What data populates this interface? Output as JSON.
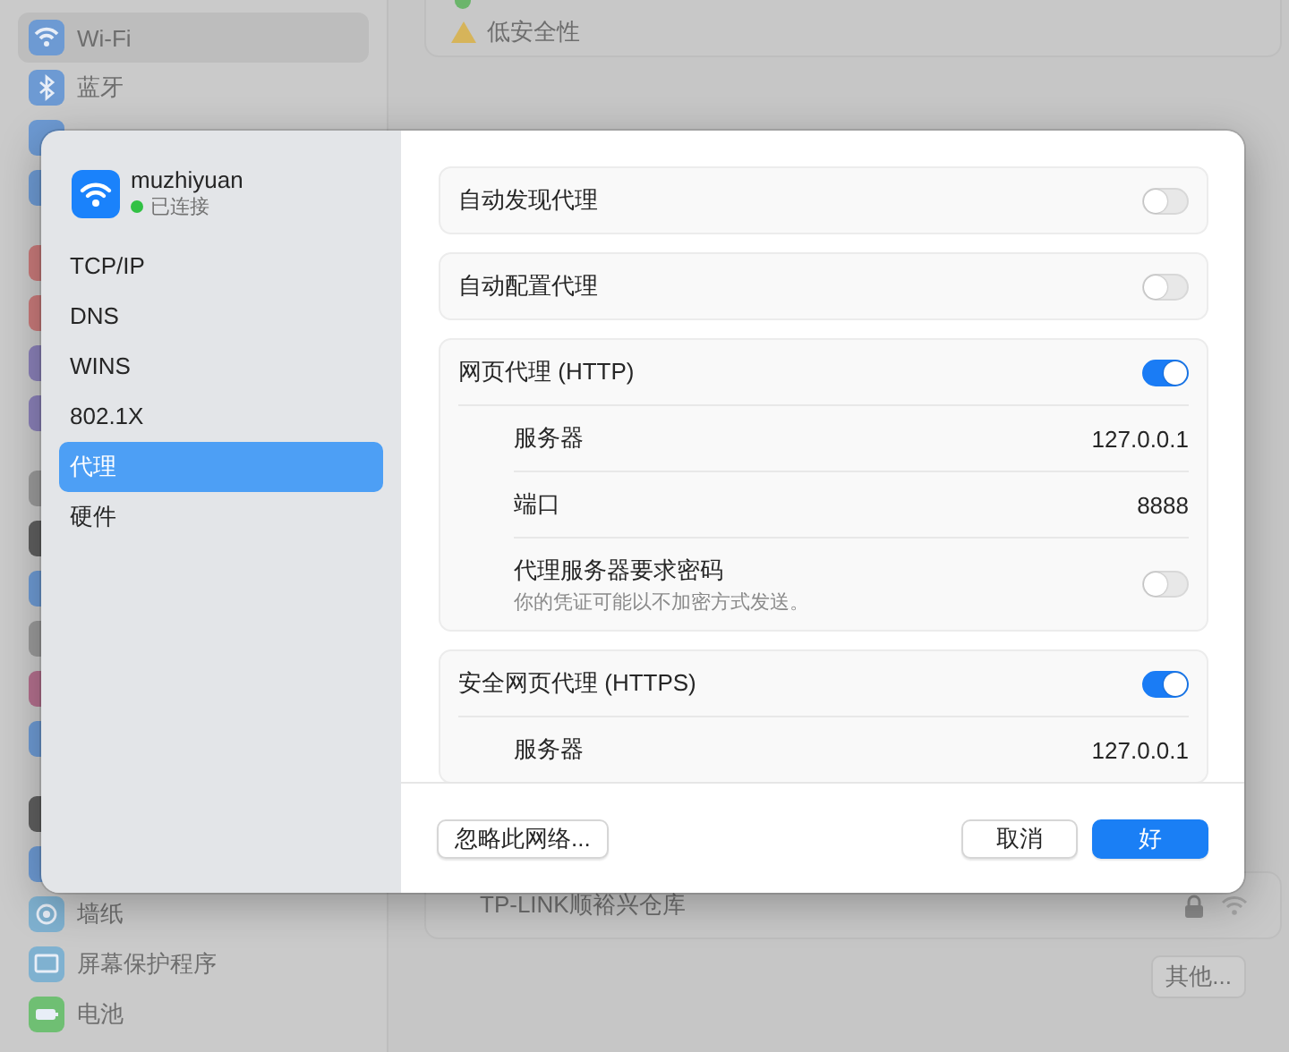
{
  "background": {
    "sidebar": [
      {
        "kind": "wifi",
        "label": "Wi-Fi",
        "selected": true
      },
      {
        "kind": "bluetooth",
        "label": "蓝牙",
        "selected": false
      },
      {
        "kind": "app"
      },
      {
        "kind": "app"
      },
      {
        "kind": "app"
      },
      {
        "kind": "app"
      },
      {
        "kind": "app"
      },
      {
        "kind": "app"
      },
      {
        "kind": "app"
      },
      {
        "kind": "app"
      },
      {
        "kind": "app"
      },
      {
        "kind": "app"
      },
      {
        "kind": "app"
      },
      {
        "kind": "app"
      },
      {
        "kind": "app"
      },
      {
        "kind": "app"
      },
      {
        "kind": "flower",
        "label": "墙纸",
        "selected": false
      },
      {
        "kind": "screen",
        "label": "屏幕保护程序",
        "selected": false
      },
      {
        "kind": "battery",
        "label": "电池",
        "selected": false
      }
    ],
    "status_items": [
      {
        "kind": "connected"
      },
      {
        "kind": "warning",
        "label": "低安全性"
      }
    ],
    "network": {
      "name": "TP-LINK顺裕兴仓库"
    },
    "other_button": "其他..."
  },
  "sheet": {
    "network": {
      "name": "muzhiyuan",
      "status": "已连接"
    },
    "nav": [
      {
        "label": "TCP/IP",
        "selected": false
      },
      {
        "label": "DNS",
        "selected": false
      },
      {
        "label": "WINS",
        "selected": false
      },
      {
        "label": "802.1X",
        "selected": false
      },
      {
        "label": "代理",
        "selected": true
      },
      {
        "label": "硬件",
        "selected": false
      }
    ],
    "groups": [
      {
        "label": "自动发现代理",
        "on": false
      },
      {
        "label": "自动配置代理",
        "on": false
      },
      {
        "label": "网页代理 (HTTP)",
        "on": true,
        "rows": [
          {
            "kind": "value",
            "label": "服务器",
            "value": "127.0.0.1"
          },
          {
            "kind": "value",
            "label": "端口",
            "value": "8888"
          },
          {
            "kind": "toggle",
            "label": "代理服务器要求密码",
            "note": "你的凭证可能以不加密方式发送。",
            "on": false
          }
        ]
      },
      {
        "label": "安全网页代理 (HTTPS)",
        "on": true,
        "rows": [
          {
            "kind": "value",
            "label": "服务器",
            "value": "127.0.0.1"
          }
        ]
      }
    ],
    "forget_button": "忽略此网络...",
    "buttons": [
      {
        "label": "取消",
        "kind": "plain"
      },
      {
        "label": "好",
        "kind": "primary"
      }
    ]
  }
}
